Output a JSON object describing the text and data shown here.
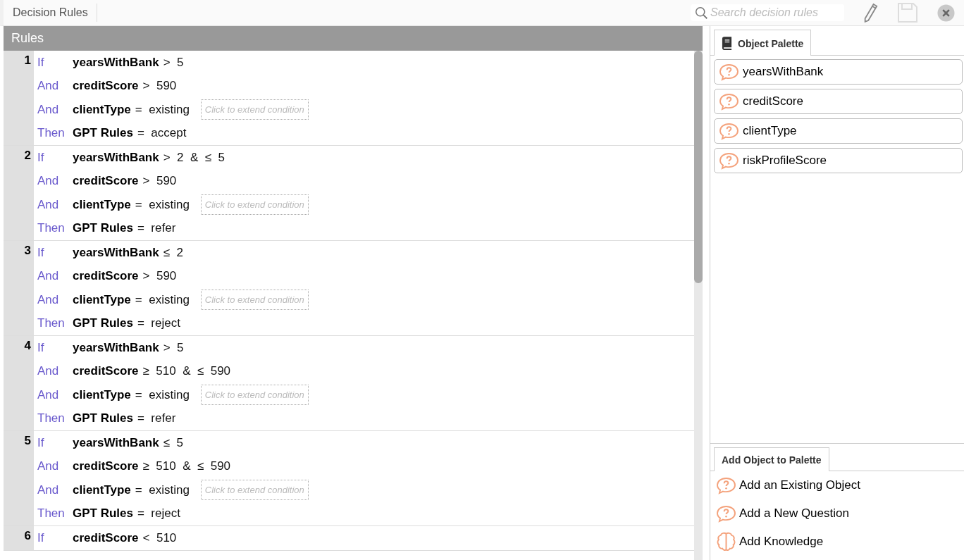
{
  "header": {
    "title": "Decision Rules",
    "search": {
      "placeholder": "Search decision rules"
    }
  },
  "rules_panel": {
    "title": "Rules",
    "rules": [
      {
        "number": "1",
        "lines": [
          {
            "keyword": "If",
            "attribute": "yearsWithBank",
            "expression": ">  5"
          },
          {
            "keyword": "And",
            "attribute": "creditScore",
            "expression": ">  590"
          },
          {
            "keyword": "And",
            "attribute": "clientType",
            "expression": "=  existing",
            "extend": "Click to extend condition"
          },
          {
            "keyword": "Then",
            "attribute": "GPT Rules",
            "expression": "=  accept"
          }
        ]
      },
      {
        "number": "2",
        "lines": [
          {
            "keyword": "If",
            "attribute": "yearsWithBank",
            "expression": ">  2  &  ≤  5"
          },
          {
            "keyword": "And",
            "attribute": "creditScore",
            "expression": ">  590"
          },
          {
            "keyword": "And",
            "attribute": "clientType",
            "expression": "=  existing",
            "extend": "Click to extend condition"
          },
          {
            "keyword": "Then",
            "attribute": "GPT Rules",
            "expression": "=  refer"
          }
        ]
      },
      {
        "number": "3",
        "lines": [
          {
            "keyword": "If",
            "attribute": "yearsWithBank",
            "expression": "≤  2"
          },
          {
            "keyword": "And",
            "attribute": "creditScore",
            "expression": ">  590"
          },
          {
            "keyword": "And",
            "attribute": "clientType",
            "expression": "=  existing",
            "extend": "Click to extend condition"
          },
          {
            "keyword": "Then",
            "attribute": "GPT Rules",
            "expression": "=  reject"
          }
        ]
      },
      {
        "number": "4",
        "lines": [
          {
            "keyword": "If",
            "attribute": "yearsWithBank",
            "expression": ">  5"
          },
          {
            "keyword": "And",
            "attribute": "creditScore",
            "expression": "≥  510  &  ≤  590"
          },
          {
            "keyword": "And",
            "attribute": "clientType",
            "expression": "=  existing",
            "extend": "Click to extend condition"
          },
          {
            "keyword": "Then",
            "attribute": "GPT Rules",
            "expression": "=  refer"
          }
        ]
      },
      {
        "number": "5",
        "lines": [
          {
            "keyword": "If",
            "attribute": "yearsWithBank",
            "expression": "≤  5"
          },
          {
            "keyword": "And",
            "attribute": "creditScore",
            "expression": "≥  510  &  ≤  590"
          },
          {
            "keyword": "And",
            "attribute": "clientType",
            "expression": "=  existing",
            "extend": "Click to extend condition"
          },
          {
            "keyword": "Then",
            "attribute": "GPT Rules",
            "expression": "=  reject"
          }
        ]
      },
      {
        "number": "6",
        "lines": [
          {
            "keyword": "If",
            "attribute": "creditScore",
            "expression": "<  510"
          }
        ]
      }
    ]
  },
  "object_palette": {
    "tab": "Object Palette",
    "objects": [
      "yearsWithBank",
      "creditScore",
      "clientType",
      "riskProfileScore"
    ]
  },
  "add_object": {
    "tab": "Add Object to Palette",
    "actions": [
      {
        "kind": "question",
        "label": "Add an Existing Object"
      },
      {
        "kind": "question",
        "label": "Add a New Question"
      },
      {
        "kind": "brain",
        "label": "Add Knowledge"
      }
    ]
  }
}
